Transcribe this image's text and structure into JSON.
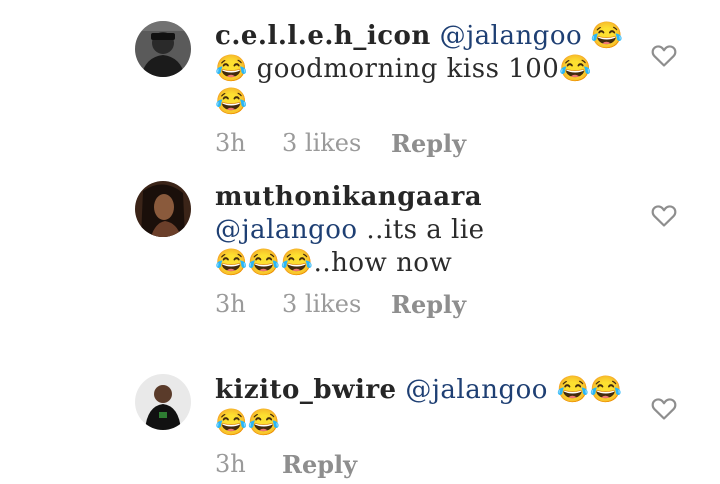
{
  "comments": [
    {
      "username": "c.e.l.l.e.h_icon",
      "mention": "@jalangoo",
      "text": " 😂😂 goodmorning kiss 100😂😂",
      "time": "3h",
      "likes": "3 likes",
      "reply": "Reply"
    },
    {
      "username": "muthonikangaara",
      "mention": "@jalangoo",
      "text": " ..its a lie😂😂😂..how now",
      "time": "3h",
      "likes": "3 likes",
      "reply": "Reply"
    },
    {
      "username": "kizito_bwire",
      "mention": "@jalangoo",
      "text": " 😂😂😂😂",
      "time": "3h",
      "likes": "",
      "reply": "Reply"
    }
  ],
  "colors": {
    "mention": "#1e3f73",
    "meta": "#9a9a9a",
    "heart_stroke": "#8e8e8e"
  },
  "icons": {
    "like": "heart-outline-icon"
  }
}
